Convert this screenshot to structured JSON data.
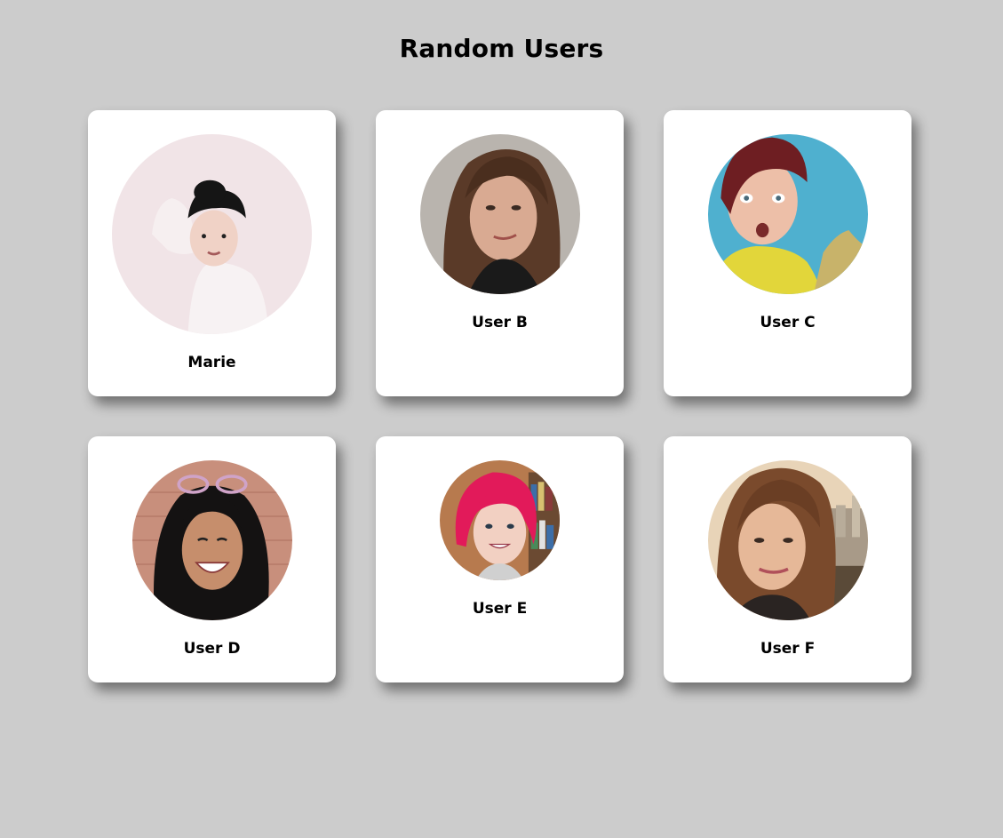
{
  "page": {
    "title": "Random Users"
  },
  "users": [
    {
      "name": "Marie",
      "avatar_icon": "person-photo-icon"
    },
    {
      "name": "User B",
      "avatar_icon": "person-photo-icon"
    },
    {
      "name": "User C",
      "avatar_icon": "person-photo-icon"
    },
    {
      "name": "User D",
      "avatar_icon": "person-photo-icon"
    },
    {
      "name": "User E",
      "avatar_icon": "person-photo-icon"
    },
    {
      "name": "User F",
      "avatar_icon": "person-photo-icon"
    }
  ],
  "colors": {
    "background": "#cccccc",
    "card": "#ffffff",
    "text": "#000000"
  }
}
